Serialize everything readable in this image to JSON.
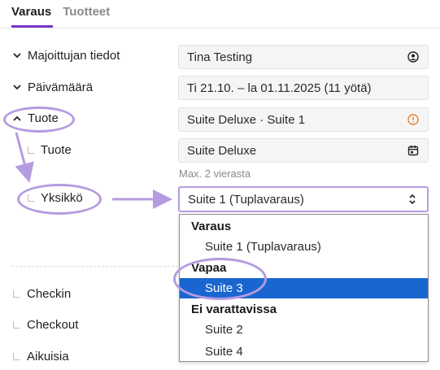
{
  "tabs": [
    {
      "label": "Varaus",
      "active": true
    },
    {
      "label": "Tuotteet",
      "active": false
    }
  ],
  "rows": {
    "guest": {
      "label": "Majoittujan tiedot",
      "value": "Tina Testing"
    },
    "date": {
      "label": "Päivämäärä",
      "value": "Ti 21.10. – la 01.11.2025 (11 yötä)"
    },
    "product": {
      "label": "Tuote",
      "value": "Suite Deluxe · Suite 1"
    },
    "product_sub": {
      "label": "Tuote",
      "value": "Suite Deluxe"
    },
    "unit": {
      "label": "Yksikkö",
      "value": "Suite 1 (Tuplavaraus)"
    }
  },
  "hint": "Max. 2 vierasta",
  "bottom_rows": [
    "Checkin",
    "Checkout",
    "Aikuisia"
  ],
  "dropdown": {
    "groups": [
      {
        "label": "Varaus",
        "options": [
          {
            "label": "Suite 1 (Tuplavaraus)",
            "selected": false
          }
        ]
      },
      {
        "label": "Vapaa",
        "options": [
          {
            "label": "Suite 3",
            "selected": true
          }
        ]
      },
      {
        "label": "Ei varattavissa",
        "options": [
          {
            "label": "Suite 2",
            "selected": false
          },
          {
            "label": "Suite 4",
            "selected": false
          }
        ]
      }
    ]
  },
  "colors": {
    "accent": "#7b35c6",
    "annotation": "#b59be0",
    "selected_bg": "#1a66d0",
    "warning": "#e8832a"
  },
  "icons": {
    "guest": "user-circle-icon",
    "product": "warning-circle-icon",
    "product_sub": "calendar-icon",
    "unit": "select-arrows-icon"
  }
}
